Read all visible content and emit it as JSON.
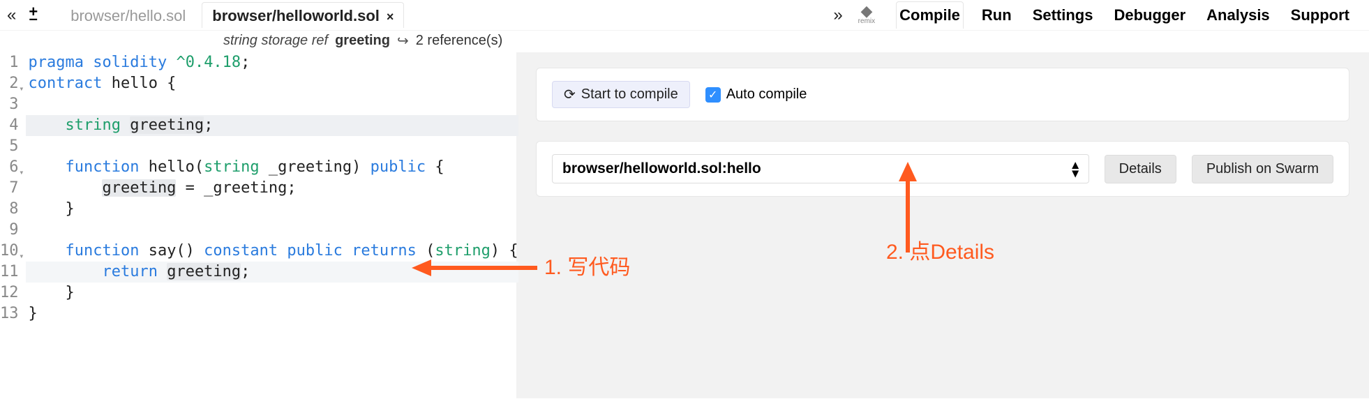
{
  "tabs": [
    {
      "label": "browser/hello.sol",
      "active": false
    },
    {
      "label": "browser/helloworld.sol",
      "active": true
    }
  ],
  "remix_label": "remix",
  "panel_tabs": [
    "Compile",
    "Run",
    "Settings",
    "Debugger",
    "Analysis",
    "Support"
  ],
  "panel_active": "Compile",
  "info": {
    "type": "string storage ref",
    "name": "greeting",
    "refs": "2 reference(s)"
  },
  "code": {
    "lines": [
      {
        "n": 1,
        "raw": "pragma solidity ^0.4.18;"
      },
      {
        "n": 2,
        "fold": true,
        "raw": "contract hello {"
      },
      {
        "n": 3,
        "raw": ""
      },
      {
        "n": 4,
        "hl": true,
        "raw": "    string greeting;"
      },
      {
        "n": 5,
        "raw": ""
      },
      {
        "n": 6,
        "fold": true,
        "raw": "    function hello(string _greeting) public {"
      },
      {
        "n": 7,
        "raw": "        greeting = _greeting;"
      },
      {
        "n": 8,
        "raw": "    }"
      },
      {
        "n": 9,
        "raw": ""
      },
      {
        "n": 10,
        "fold": true,
        "raw": "    function say() constant public returns (string) {"
      },
      {
        "n": 11,
        "cursor": true,
        "raw": "        return greeting;"
      },
      {
        "n": 12,
        "raw": "    }"
      },
      {
        "n": 13,
        "raw": "}"
      }
    ]
  },
  "compile": {
    "start_btn": "Start to compile",
    "auto_label": "Auto compile",
    "auto_checked": true,
    "contract_select": "browser/helloworld.sol:hello",
    "details_btn": "Details",
    "publish_btn": "Publish on Swarm"
  },
  "annotations": {
    "step1": "1. 写代码",
    "step2": "2. 点Details"
  }
}
